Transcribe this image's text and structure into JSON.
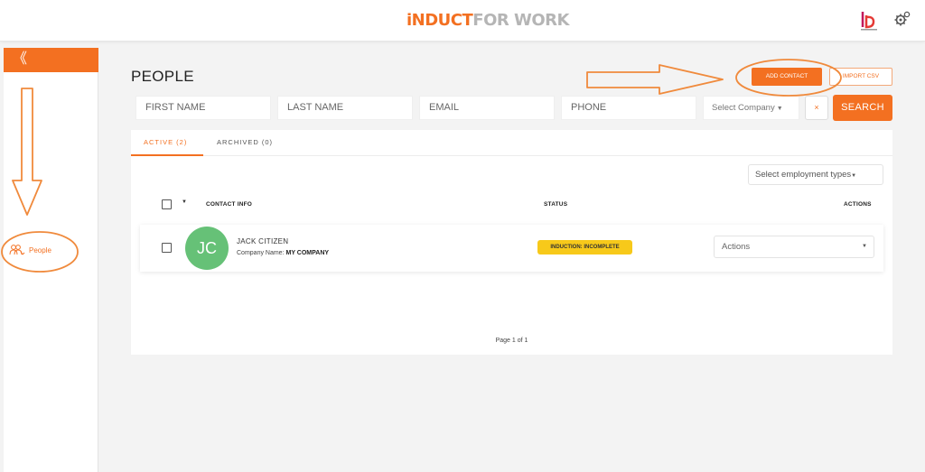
{
  "app": {
    "logo_part1": "iNDUCT",
    "logo_part2": "FOR WORK"
  },
  "sidebar": {
    "collapse_label": "《",
    "items": [
      {
        "label": "People",
        "icon": "people-icon",
        "active": true
      }
    ]
  },
  "page": {
    "title": "PEOPLE"
  },
  "toolbar": {
    "add_contact_label": "ADD CONTACT",
    "import_csv_label": "IMPORT CSV"
  },
  "filters": {
    "first_name_placeholder": "FIRST NAME",
    "last_name_placeholder": "LAST NAME",
    "email_placeholder": "EMAIL",
    "phone_placeholder": "PHONE",
    "company_select": "Select Company",
    "clear_label": "×",
    "search_label": "SEARCH"
  },
  "tabs": [
    {
      "label": "ACTIVE (2)",
      "active": true
    },
    {
      "label": "ARCHIVED (0)",
      "active": false
    }
  ],
  "employment_select": "Select employment types",
  "table": {
    "columns": [
      "CONTACT INFO",
      "STATUS",
      "ACTIONS"
    ],
    "rows": [
      {
        "initials": "JC",
        "name": "JACK CITIZEN",
        "company_label": "Company Name:",
        "company_value": "MY COMPANY",
        "status": "INDUCTION: INCOMPLETE",
        "actions_label": "Actions"
      }
    ]
  },
  "pagination": {
    "text": "Page 1 of 1"
  },
  "colors": {
    "accent": "#f37021",
    "avatar": "#66c177",
    "status_badge": "#f7c91a",
    "logo_grey": "#b5b5b5"
  }
}
